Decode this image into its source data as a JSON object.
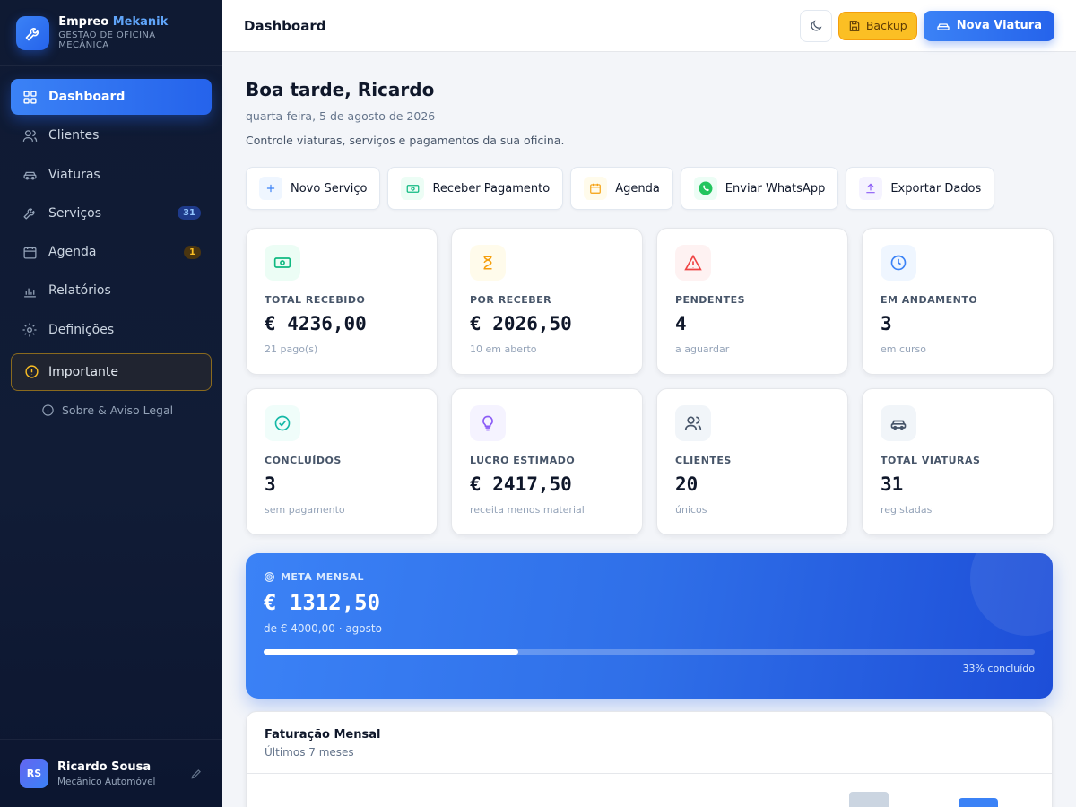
{
  "brand": {
    "name_part1": "Empreo",
    "name_part2": "Mekanik",
    "subtitle": "GESTÃO DE OFICINA MECÂNICA"
  },
  "sidebar": {
    "items": [
      {
        "label": "Dashboard",
        "icon": "grid-icon"
      },
      {
        "label": "Clientes",
        "icon": "users-icon"
      },
      {
        "label": "Viaturas",
        "icon": "car-icon"
      },
      {
        "label": "Serviços",
        "icon": "wrench-icon",
        "badge": "31"
      },
      {
        "label": "Agenda",
        "icon": "calendar-icon",
        "badge": "1"
      },
      {
        "label": "Relatórios",
        "icon": "bar-chart-icon"
      },
      {
        "label": "Definições",
        "icon": "gear-icon"
      }
    ],
    "important": "Importante",
    "about": "Sobre & Aviso Legal"
  },
  "user": {
    "initials": "RS",
    "name": "Ricardo Sousa",
    "role": "Mecânico Automóvel"
  },
  "header": {
    "title": "Dashboard",
    "backup_label": "Backup",
    "new_vehicle_label": "Nova Viatura"
  },
  "main": {
    "greeting": "Boa tarde, Ricardo",
    "date": "quarta-feira, 5 de agosto de 2026",
    "subtitle": "Controle viaturas, serviços e pagamentos da sua oficina."
  },
  "actions": [
    {
      "label": "Novo Serviço",
      "icon": "plus-icon"
    },
    {
      "label": "Receber Pagamento",
      "icon": "banknote-icon"
    },
    {
      "label": "Agenda",
      "icon": "calendar-icon"
    },
    {
      "label": "Enviar WhatsApp",
      "icon": "whatsapp-icon"
    },
    {
      "label": "Exportar Dados",
      "icon": "upload-icon"
    }
  ],
  "stats": [
    {
      "label": "TOTAL RECEBIDO",
      "value": "€ 4236,00",
      "note": "21 pago(s)",
      "icon": "banknote-icon",
      "color": "#10b981",
      "bg": "#ecfdf5"
    },
    {
      "label": "POR RECEBER",
      "value": "€ 2026,50",
      "note": "10 em aberto",
      "icon": "hourglass-icon",
      "color": "#f59e0b",
      "bg": "#fffbeb"
    },
    {
      "label": "PENDENTES",
      "value": "4",
      "note": "a aguardar",
      "icon": "alert-triangle-icon",
      "color": "#ef4444",
      "bg": "#fef2f2"
    },
    {
      "label": "EM ANDAMENTO",
      "value": "3",
      "note": "em curso",
      "icon": "clock-icon",
      "color": "#3b82f6",
      "bg": "#eff6ff"
    },
    {
      "label": "CONCLUÍDOS",
      "value": "3",
      "note": "sem pagamento",
      "icon": "check-circle-icon",
      "color": "#14b8a6",
      "bg": "#f0fdfa"
    },
    {
      "label": "LUCRO ESTIMADO",
      "value": "€ 2417,50",
      "note": "receita menos material",
      "icon": "lightbulb-icon",
      "color": "#8b5cf6",
      "bg": "#f5f3ff"
    },
    {
      "label": "CLIENTES",
      "value": "20",
      "note": "únicos",
      "icon": "users-icon",
      "color": "#475569",
      "bg": "#f1f5f9"
    },
    {
      "label": "TOTAL VIATURAS",
      "value": "31",
      "note": "registadas",
      "icon": "car-icon",
      "color": "#475569",
      "bg": "#f1f5f9"
    }
  ],
  "goal": {
    "label": "META MENSAL",
    "value": "€ 1312,50",
    "subtitle": "de € 4000,00 · agosto",
    "progress_percent": 33,
    "progress_text": "33% concluído"
  },
  "revenue": {
    "title": "Faturação Mensal",
    "subtitle": "Últimos 7 meses"
  }
}
